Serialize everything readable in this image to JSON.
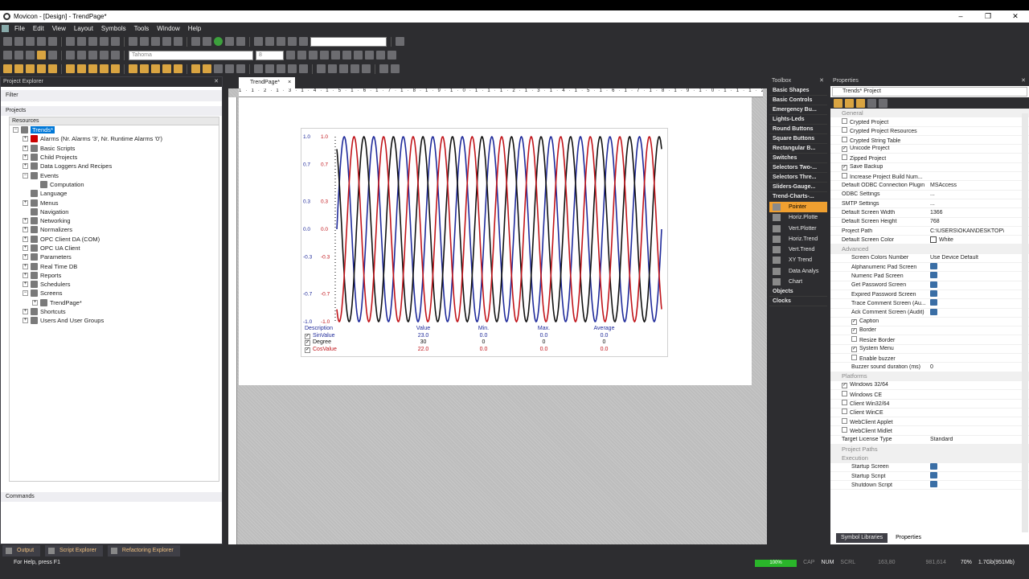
{
  "window": {
    "title": "Movicon - [Design] - TrendPage*",
    "minimize": "–",
    "maximize": "❐",
    "close": "✕"
  },
  "menu": [
    "File",
    "Edit",
    "View",
    "Layout",
    "Symbols",
    "Tools",
    "Window",
    "Help"
  ],
  "toolbar": {
    "font_name": "Tahoma",
    "font_size": "8"
  },
  "project_explorer": {
    "title": "Project Explorer",
    "filter_label": "Filter",
    "projects_label": "Projects",
    "column_header": "Resources",
    "commands_label": "Commands",
    "nodes": [
      {
        "label": "Trends*",
        "level": 0,
        "toggle": "−",
        "selected": true
      },
      {
        "label": "Alarms (Nr. Alarms '3', Nr. Runtime Alarms '0')",
        "level": 1,
        "toggle": "+"
      },
      {
        "label": "Basic Scripts",
        "level": 1,
        "toggle": "+"
      },
      {
        "label": "Child Projects",
        "level": 1,
        "toggle": "+"
      },
      {
        "label": "Data Loggers And Recipes",
        "level": 1,
        "toggle": "+"
      },
      {
        "label": "Events",
        "level": 1,
        "toggle": "−"
      },
      {
        "label": "Computation",
        "level": 2,
        "toggle": ""
      },
      {
        "label": "Language",
        "level": 1,
        "toggle": ""
      },
      {
        "label": "Menus",
        "level": 1,
        "toggle": "+"
      },
      {
        "label": "Navigation",
        "level": 1,
        "toggle": ""
      },
      {
        "label": "Networking",
        "level": 1,
        "toggle": "+"
      },
      {
        "label": "Normalizers",
        "level": 1,
        "toggle": "+"
      },
      {
        "label": "OPC Client DA (COM)",
        "level": 1,
        "toggle": "+"
      },
      {
        "label": "OPC UA Client",
        "level": 1,
        "toggle": "+"
      },
      {
        "label": "Parameters",
        "level": 1,
        "toggle": "+"
      },
      {
        "label": "Real Time DB",
        "level": 1,
        "toggle": "+"
      },
      {
        "label": "Reports",
        "level": 1,
        "toggle": "+"
      },
      {
        "label": "Schedulers",
        "level": 1,
        "toggle": "+"
      },
      {
        "label": "Screens",
        "level": 1,
        "toggle": "−"
      },
      {
        "label": "TrendPage*",
        "level": 2,
        "toggle": "+"
      },
      {
        "label": "Shortcuts",
        "level": 1,
        "toggle": "+"
      },
      {
        "label": "Users And User Groups",
        "level": 1,
        "toggle": "+"
      }
    ]
  },
  "document": {
    "tab_label": "TrendPage*",
    "tab_close": "×"
  },
  "ruler_text": "1 · 1 · 2 · 1 · 3 · 1 · 4 · 1 · 5 · 1 · 6 · 1 · 7 · 1 · 8 · 1 · 9 · 1 · 0 · 1 · 1 · 1 · 2 · 1 · 3 · 1 · 4 · 1 · 5 · 1 · 6 · 1 · 7 · 1 · 8 · 1 · 9 · 1 · 0 · 1 · 1 · 1 · 2 · 1 · 3 · 1 · 4 · 1 · 5",
  "chart_data": {
    "type": "line",
    "ylim": [
      -1.0,
      1.0
    ],
    "y_ticks_left": [
      "1.0",
      "0.7",
      "0.3",
      "0.0",
      "-0.3",
      "-0.7",
      "-1.0"
    ],
    "y_ticks_right": [
      "1.0",
      "0.7",
      "0.3",
      "0.0",
      "-0.3",
      "-0.7",
      "-1.0"
    ],
    "cycles": 11,
    "series": [
      {
        "name": "SinValue",
        "color": "#1f2a9a",
        "phase_deg": 0
      },
      {
        "name": "Degree",
        "color": "#111111",
        "phase_deg": 120
      },
      {
        "name": "CosValue",
        "color": "#c0141a",
        "phase_deg": 240
      }
    ],
    "legend": {
      "headers": [
        "Description",
        "Value",
        "Min.",
        "Max.",
        "Average"
      ],
      "rows": [
        {
          "name": "SinValue",
          "value": "23.0",
          "min": "0.0",
          "max": "0.0",
          "avg": "0.0",
          "color": "#1f2a9a"
        },
        {
          "name": "Degree",
          "value": "30",
          "min": "0",
          "max": "0",
          "avg": "0",
          "color": "#111111"
        },
        {
          "name": "CosValue",
          "value": "22.0",
          "min": "0.0",
          "max": "0.0",
          "avg": "0.0",
          "color": "#c0141a"
        }
      ]
    }
  },
  "toolbox": {
    "title": "Toolbox",
    "categories_top": [
      "Basic Shapes",
      "Basic Controls",
      "Emergency Bu...",
      "Lights-Leds",
      "Round Buttons",
      "Square Buttons",
      "Rectangular B...",
      "Switches",
      "Selectors Two-...",
      "Selectors Thre...",
      "Sliders-Gauge...",
      "Trend-Charts-..."
    ],
    "items": [
      "Pointer",
      "Horiz.Plotte",
      "Vert.Plotter",
      "Horiz.Trend",
      "Vert.Trend",
      "XY Trend",
      "Data Analys",
      "Chart"
    ],
    "categories_bottom": [
      "Objects",
      "Clocks"
    ]
  },
  "properties": {
    "title": "Properties",
    "selector": "Trends* Project",
    "rows": [
      {
        "t": "cat",
        "n": "General"
      },
      {
        "t": "chk",
        "n": "Crypted Project",
        "c": false
      },
      {
        "t": "chk",
        "n": "Crypted Project Resources",
        "c": false
      },
      {
        "t": "chk",
        "n": "Crypted String Table",
        "c": false
      },
      {
        "t": "chk",
        "n": "Unicode Project",
        "c": true
      },
      {
        "t": "chk",
        "n": "Zipped Project",
        "c": false
      },
      {
        "t": "chk",
        "n": "Save Backup",
        "c": true
      },
      {
        "t": "chk",
        "n": "Increase Project Build Num...",
        "c": false
      },
      {
        "t": "val",
        "n": "Default ODBC Connection Plugin",
        "v": "MSAccess"
      },
      {
        "t": "val",
        "n": "ODBC Settings",
        "v": "..."
      },
      {
        "t": "val",
        "n": "SMTP Settings",
        "v": "..."
      },
      {
        "t": "val",
        "n": "Default Screen Width",
        "v": "1366"
      },
      {
        "t": "val",
        "n": "Default Screen Height",
        "v": "768"
      },
      {
        "t": "val",
        "n": "Project Path",
        "v": "C:\\USERS\\OKAN\\DESKTOP\\"
      },
      {
        "t": "col",
        "n": "Default Screen Color",
        "v": "White"
      },
      {
        "t": "sub",
        "n": "Advanced"
      },
      {
        "t": "val2",
        "n": "Screen Colors Number",
        "v": "Use Device Default"
      },
      {
        "t": "ico",
        "n": "Alphanumeric Pad Screen"
      },
      {
        "t": "ico",
        "n": "Numeric Pad Screen"
      },
      {
        "t": "ico",
        "n": "Get Password Screen"
      },
      {
        "t": "ico",
        "n": "Expired Password Screen"
      },
      {
        "t": "ico",
        "n": "Trace Comment Screen (Au..."
      },
      {
        "t": "ico",
        "n": "Ack Comment Screen (Audit)"
      },
      {
        "t": "chk2",
        "n": "Caption",
        "c": true
      },
      {
        "t": "chk2",
        "n": "Border",
        "c": true
      },
      {
        "t": "chk2",
        "n": "Resize Border",
        "c": false
      },
      {
        "t": "chk2",
        "n": "System Menu",
        "c": true
      },
      {
        "t": "chk2",
        "n": "Enable buzzer",
        "c": false
      },
      {
        "t": "val2",
        "n": "Buzzer sound duration (ms)",
        "v": "0"
      },
      {
        "t": "cat",
        "n": "Platforms"
      },
      {
        "t": "chk",
        "n": "Windows 32/64",
        "c": true
      },
      {
        "t": "chk",
        "n": "Windows CE",
        "c": false
      },
      {
        "t": "chk",
        "n": "Client Win32/64",
        "c": false
      },
      {
        "t": "chk",
        "n": "Client WinCE",
        "c": false
      },
      {
        "t": "chk",
        "n": "WebClient Applet",
        "c": false
      },
      {
        "t": "chk",
        "n": "WebClient Midlet",
        "c": false
      },
      {
        "t": "val",
        "n": "Target License Type",
        "v": "Standard"
      },
      {
        "t": "cat",
        "n": "Project Paths"
      },
      {
        "t": "cat",
        "n": "Execution"
      },
      {
        "t": "ico",
        "n": "Startup Screen"
      },
      {
        "t": "ico",
        "n": "Startup Script"
      },
      {
        "t": "ico",
        "n": "Shutdown Script"
      }
    ],
    "tab_symbols": "Symbol Libraries",
    "tab_properties": "Properties"
  },
  "bottom_tabs": [
    "Output",
    "Script Explorer",
    "Refactoring Explorer"
  ],
  "status": {
    "help": "For Help, press F1",
    "progress": "100%",
    "caps": "CAP",
    "num": "NUM",
    "scrl": "SCRL",
    "pos": "163,80",
    "size": "981,614",
    "zoom": "70%",
    "memory": "1.7Gb(951Mb)"
  }
}
